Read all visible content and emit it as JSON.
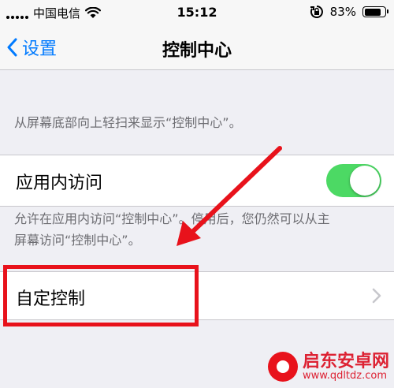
{
  "status_bar": {
    "carrier": "中国电信",
    "time": "15:12",
    "battery_percent": "83%",
    "battery_level": 0.83,
    "icons": [
      "signal-bars-icon",
      "wifi-icon",
      "rotation-lock-icon",
      "battery-icon"
    ]
  },
  "nav": {
    "back_label": "设置",
    "title": "控制中心"
  },
  "section1": {
    "footer": "从屏幕底部向上轻扫来显示“控制中心”。"
  },
  "access_in_apps": {
    "label": "应用内访问",
    "toggle_on": true,
    "toggle_color": "#4cd964",
    "footer_line1": "允许在应用内访问“控制中心”。停用后，您仍然可以从主",
    "footer_line2": "屏幕访问“控制中心”。"
  },
  "customize": {
    "label": "自定控制",
    "chevron": "chevron-right-icon"
  },
  "annotation": {
    "color": "#e8121b"
  },
  "watermark": {
    "title": "启东安卓网",
    "url": "www.qdltdz.com"
  }
}
